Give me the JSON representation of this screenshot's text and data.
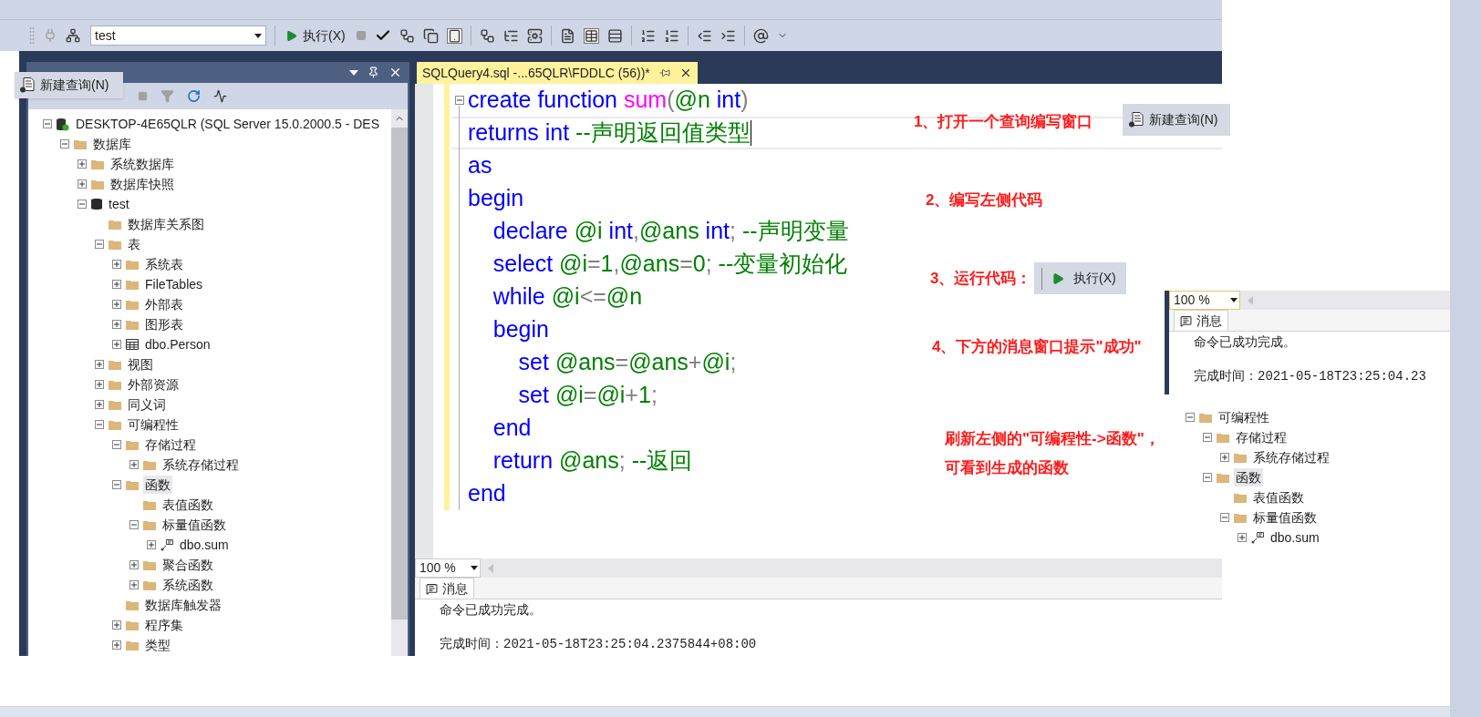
{
  "toolbar": {
    "database": "test",
    "execute": "执行(X)"
  },
  "new_query_popup": {
    "label": "新建查询(N)"
  },
  "object_explorer": {
    "tree": [
      {
        "label": "DESKTOP-4E65QLR (SQL Server 15.0.2000.5 - DES",
        "kind": "server",
        "expanded": true,
        "selected": false,
        "children": [
          {
            "label": "数据库",
            "kind": "folder",
            "expanded": true,
            "selected": false,
            "children": [
              {
                "label": "系统数据库",
                "kind": "folder",
                "expanded": false,
                "selected": false
              },
              {
                "label": "数据库快照",
                "kind": "folder",
                "expanded": false,
                "selected": false
              },
              {
                "label": "test",
                "kind": "database",
                "expanded": true,
                "selected": false,
                "children": [
                  {
                    "label": "数据库关系图",
                    "kind": "folder",
                    "selected": false
                  },
                  {
                    "label": "表",
                    "kind": "folder",
                    "expanded": true,
                    "selected": false,
                    "children": [
                      {
                        "label": "系统表",
                        "kind": "folder",
                        "expanded": false,
                        "selected": false
                      },
                      {
                        "label": "FileTables",
                        "kind": "folder",
                        "expanded": false,
                        "selected": false
                      },
                      {
                        "label": "外部表",
                        "kind": "folder",
                        "expanded": false,
                        "selected": false
                      },
                      {
                        "label": "图形表",
                        "kind": "folder",
                        "expanded": false,
                        "selected": false
                      },
                      {
                        "label": "dbo.Person",
                        "kind": "table",
                        "expanded": false,
                        "selected": false
                      }
                    ]
                  },
                  {
                    "label": "视图",
                    "kind": "folder",
                    "expanded": false,
                    "selected": false
                  },
                  {
                    "label": "外部资源",
                    "kind": "folder",
                    "expanded": false,
                    "selected": false
                  },
                  {
                    "label": "同义词",
                    "kind": "folder",
                    "expanded": false,
                    "selected": false
                  },
                  {
                    "label": "可编程性",
                    "kind": "folder",
                    "expanded": true,
                    "selected": false,
                    "children": [
                      {
                        "label": "存储过程",
                        "kind": "folder",
                        "expanded": true,
                        "selected": false,
                        "children": [
                          {
                            "label": "系统存储过程",
                            "kind": "folder",
                            "expanded": false,
                            "selected": false
                          }
                        ]
                      },
                      {
                        "label": "函数",
                        "kind": "folder",
                        "expanded": true,
                        "selected": true,
                        "children": [
                          {
                            "label": "表值函数",
                            "kind": "folder",
                            "selected": false
                          },
                          {
                            "label": "标量值函数",
                            "kind": "folder",
                            "expanded": true,
                            "selected": false,
                            "children": [
                              {
                                "label": "dbo.sum",
                                "kind": "function",
                                "expanded": false,
                                "selected": false
                              }
                            ]
                          },
                          {
                            "label": "聚合函数",
                            "kind": "folder",
                            "expanded": false,
                            "selected": false
                          },
                          {
                            "label": "系统函数",
                            "kind": "folder",
                            "expanded": false,
                            "selected": false
                          }
                        ]
                      },
                      {
                        "label": "数据库触发器",
                        "kind": "folder",
                        "selected": false
                      },
                      {
                        "label": "程序集",
                        "kind": "folder",
                        "expanded": false,
                        "selected": false
                      },
                      {
                        "label": "类型",
                        "kind": "folder",
                        "expanded": false,
                        "selected": false
                      }
                    ]
                  }
                ]
              }
            ]
          }
        ]
      }
    ]
  },
  "editor": {
    "tab": {
      "title": "SQLQuery4.sql -...65QLR\\FDDLC (56))*",
      "selected": true
    },
    "lines": [
      {
        "current": false,
        "tokens": [
          {
            "kind": "keyword",
            "text": "create function "
          },
          {
            "kind": "function",
            "text": "sum"
          },
          {
            "kind": "operator",
            "text": "("
          },
          {
            "kind": "variable",
            "text": "@n"
          },
          {
            "kind": "keyword",
            "text": " int"
          },
          {
            "kind": "operator",
            "text": ")"
          }
        ]
      },
      {
        "current": true,
        "tokens": [
          {
            "kind": "keyword",
            "text": "returns int "
          },
          {
            "kind": "comment",
            "text": "--声明返回值类型"
          }
        ]
      },
      {
        "current": false,
        "tokens": [
          {
            "kind": "keyword",
            "text": "as"
          }
        ]
      },
      {
        "current": false,
        "tokens": [
          {
            "kind": "keyword",
            "text": "begin"
          }
        ]
      },
      {
        "current": false,
        "tokens": [
          {
            "kind": "keyword",
            "text": "    declare "
          },
          {
            "kind": "variable",
            "text": "@i"
          },
          {
            "kind": "keyword",
            "text": " int"
          },
          {
            "kind": "operator",
            "text": ","
          },
          {
            "kind": "variable",
            "text": "@ans"
          },
          {
            "kind": "keyword",
            "text": " int"
          },
          {
            "kind": "operator",
            "text": ";"
          },
          {
            "kind": "comment",
            "text": " --声明变量"
          }
        ]
      },
      {
        "current": false,
        "tokens": [
          {
            "kind": "keyword",
            "text": "    select "
          },
          {
            "kind": "variable",
            "text": "@i"
          },
          {
            "kind": "operator",
            "text": "="
          },
          {
            "kind": "number",
            "text": "1"
          },
          {
            "kind": "operator",
            "text": ","
          },
          {
            "kind": "variable",
            "text": "@ans"
          },
          {
            "kind": "operator",
            "text": "="
          },
          {
            "kind": "number",
            "text": "0"
          },
          {
            "kind": "operator",
            "text": ";"
          },
          {
            "kind": "comment",
            "text": " --变量初始化"
          }
        ]
      },
      {
        "current": false,
        "tokens": [
          {
            "kind": "keyword",
            "text": "    while "
          },
          {
            "kind": "variable",
            "text": "@i"
          },
          {
            "kind": "operator",
            "text": "<="
          },
          {
            "kind": "variable",
            "text": "@n"
          }
        ]
      },
      {
        "current": false,
        "tokens": [
          {
            "kind": "keyword",
            "text": "    begin"
          }
        ]
      },
      {
        "current": false,
        "tokens": [
          {
            "kind": "keyword",
            "text": "        set "
          },
          {
            "kind": "variable",
            "text": "@ans"
          },
          {
            "kind": "operator",
            "text": "="
          },
          {
            "kind": "variable",
            "text": "@ans"
          },
          {
            "kind": "operator",
            "text": "+"
          },
          {
            "kind": "variable",
            "text": "@i"
          },
          {
            "kind": "operator",
            "text": ";"
          }
        ]
      },
      {
        "current": false,
        "tokens": [
          {
            "kind": "keyword",
            "text": "        set "
          },
          {
            "kind": "variable",
            "text": "@i"
          },
          {
            "kind": "operator",
            "text": "="
          },
          {
            "kind": "variable",
            "text": "@i"
          },
          {
            "kind": "operator",
            "text": "+"
          },
          {
            "kind": "number",
            "text": "1"
          },
          {
            "kind": "operator",
            "text": ";"
          }
        ]
      },
      {
        "current": false,
        "tokens": [
          {
            "kind": "keyword",
            "text": "    end"
          }
        ]
      },
      {
        "current": false,
        "tokens": [
          {
            "kind": "keyword",
            "text": "    return "
          },
          {
            "kind": "variable",
            "text": "@ans"
          },
          {
            "kind": "operator",
            "text": ";"
          },
          {
            "kind": "comment",
            "text": " --返回"
          }
        ]
      },
      {
        "current": false,
        "tokens": [
          {
            "kind": "keyword",
            "text": "end"
          }
        ]
      }
    ]
  },
  "messages": {
    "zoom": "100 %",
    "tab": "消息",
    "result": "命令已成功完成。",
    "time_label": "完成时间：",
    "time": "2021-05-18T23:25:04.2375844+08:00"
  },
  "guide": [
    {
      "lines": [
        "1、打开一个查询编写窗口"
      ],
      "button": {
        "kind": "new_query",
        "label": "新建查询(N)"
      }
    },
    {
      "lines": [
        "2、编写左侧代码"
      ]
    },
    {
      "lines": [
        "3、运行代码："
      ],
      "button": {
        "kind": "execute",
        "label": "执行(X)"
      }
    },
    {
      "lines": [
        "4、下方的消息窗口提示\"成功\""
      ]
    },
    {
      "lines": [
        "刷新左侧的\"可编程性->函数\"，",
        "可看到生成的函数"
      ]
    }
  ],
  "messages_inset": {
    "zoom": "100 %",
    "tab": "消息",
    "result": "命令已成功完成。",
    "time_label": "完成时间：",
    "time": "2021-05-18T23:25:04.23"
  },
  "tree_inset": [
    {
      "label": "可编程性",
      "kind": "folder",
      "expanded": true,
      "selected": false,
      "children": [
        {
          "label": "存储过程",
          "kind": "folder",
          "expanded": true,
          "selected": false,
          "children": [
            {
              "label": "系统存储过程",
              "kind": "folder",
              "expanded": false,
              "selected": false
            }
          ]
        },
        {
          "label": "函数",
          "kind": "folder",
          "expanded": true,
          "selected": true,
          "children": [
            {
              "label": "表值函数",
              "kind": "folder",
              "selected": false
            },
            {
              "label": "标量值函数",
              "kind": "folder",
              "expanded": true,
              "selected": false,
              "children": [
                {
                  "label": "dbo.sum",
                  "kind": "function",
                  "expanded": false,
                  "selected": false
                }
              ]
            }
          ]
        }
      ]
    }
  ]
}
